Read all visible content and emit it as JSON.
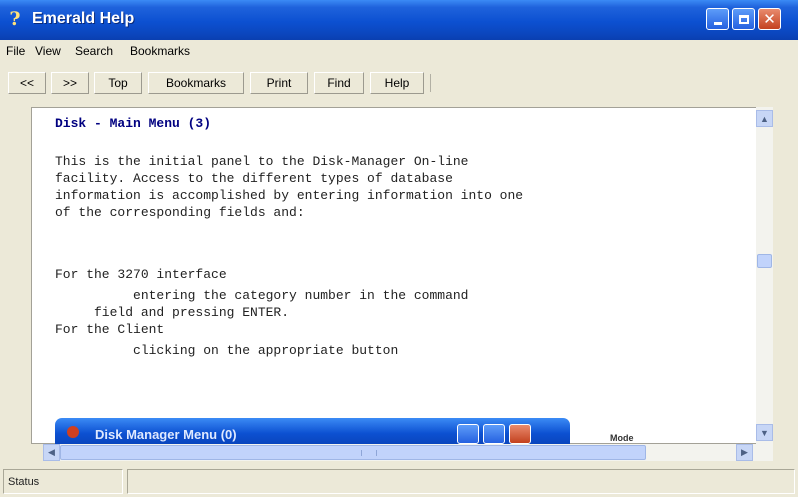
{
  "window": {
    "title": "Emerald Help",
    "app_icon": "question-mark-icon",
    "controls": [
      "minimize-icon",
      "maximize-icon",
      "close-icon"
    ]
  },
  "menu": {
    "file": "File",
    "view": "View",
    "search": "Search",
    "bookmarks": "Bookmarks"
  },
  "toolbar": {
    "back": "<<",
    "forward": ">>",
    "top": "Top",
    "bookmarks": "Bookmarks",
    "print": "Print",
    "find": "Find",
    "help": "Help"
  },
  "content": {
    "heading": "Disk - Main Menu (3)",
    "para_lines": [
      "This is the initial panel to the Disk-Manager On-line",
      "facility. Access to the different types of database",
      "information is accomplished by entering information into one",
      "of the corresponding fields and:"
    ],
    "list_lines": [
      "For the 3270 interface",
      "          entering the category number in the command",
      "     field and pressing ENTER.",
      "For the Client",
      "          clicking on the appropriate button"
    ]
  },
  "child_window": {
    "title": "Disk Manager Menu (0)",
    "mode_label": "Mode"
  },
  "status": {
    "label": "Status",
    "message": ""
  },
  "colors": {
    "title_bar": "#0c50d1",
    "heading_text": "#000080",
    "close_button": "#c3411f"
  }
}
